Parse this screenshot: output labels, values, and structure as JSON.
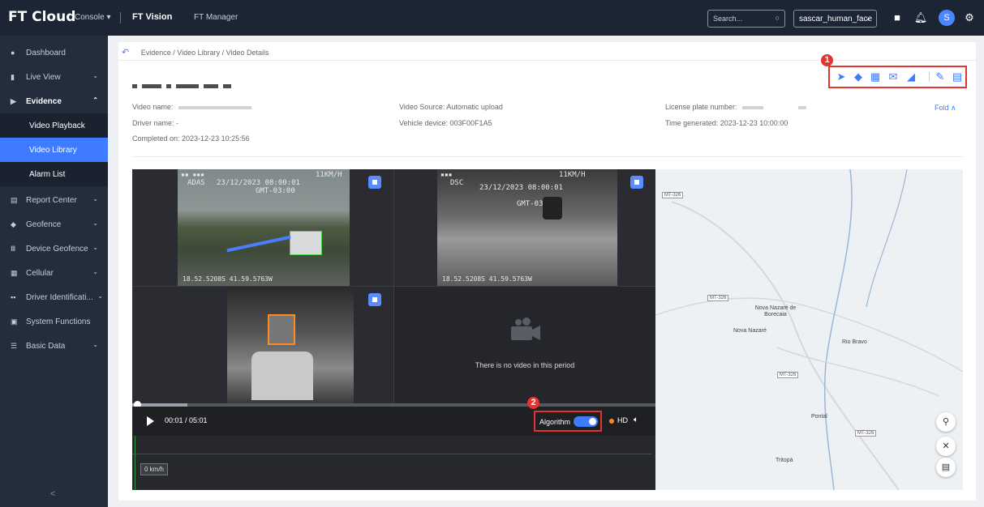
{
  "topbar": {
    "brand": "FT Cloud",
    "console": "Console ▾",
    "nav": [
      "FT Vision",
      "FT Manager"
    ],
    "search_placeholder": "Search...",
    "account": "sascar_human_face",
    "avatar_initial": "S"
  },
  "sidebar": {
    "items": [
      {
        "label": "Dashboard",
        "icon": "dashboard-icon"
      },
      {
        "label": "Live View",
        "icon": "live-icon",
        "chevron": "⌄"
      },
      {
        "label": "Evidence",
        "icon": "evidence-icon",
        "chevron": "⌃"
      },
      {
        "label": "Report Center",
        "icon": "report-icon",
        "chevron": "⌄"
      },
      {
        "label": "Geofence",
        "icon": "geofence-icon",
        "chevron": "⌄"
      },
      {
        "label": "Device Geofence",
        "icon": "device-geofence-icon",
        "chevron": "⌄"
      },
      {
        "label": "Cellular",
        "icon": "cellular-icon",
        "chevron": "⌄"
      },
      {
        "label": "Driver Identificati...",
        "icon": "driver-icon",
        "chevron": "⌄"
      },
      {
        "label": "System Functions",
        "icon": "system-icon"
      },
      {
        "label": "Basic Data",
        "icon": "data-icon",
        "chevron": "⌄"
      }
    ],
    "sub_items": [
      {
        "label": "Video Playback"
      },
      {
        "label": "Video Library",
        "active": true
      },
      {
        "label": "Alarm List"
      }
    ],
    "collapse": "<"
  },
  "breadcrumb": {
    "parts": "Evidence / Video Library / Video Details"
  },
  "callouts": [
    "1",
    "2"
  ],
  "details": {
    "video_name_label": "Video name:",
    "driver_name": "Driver name: -",
    "completed_on": "Completed on: 2023-12-23 10:25:56",
    "video_source": "Video Source: Automatic upload",
    "vehicle_device": "Vehicle device: 003F00F1A5",
    "license_plate_label": "License plate number:",
    "time_generated": "Time generated: 2023-12-23 10:00:00",
    "fold": "Fold ∧"
  },
  "cameras": {
    "cam1": {
      "top_left": "ADAS",
      "date": "23/12/2023 08:00:01",
      "gmt": "GMT-03:00",
      "speed": "11KM/H",
      "coords": "18.52.5208S 41.59.5763W"
    },
    "cam2": {
      "top_left": "DSC",
      "date": "23/12/2023 08:00:01",
      "gmt": "GMT-03:00",
      "speed": "11KM/H",
      "coords": "18.52.5208S 41.59.5763W"
    },
    "no_video": "There is no video in this period"
  },
  "player": {
    "time": "00:01 / 05:01",
    "progress_fraction": 0.003,
    "algorithm_label": "Algorithm",
    "algorithm_on": true,
    "hd": "HD",
    "speed_tag": "0 km/h"
  },
  "map": {
    "places": [
      "Nova Nazaré de Borecaia",
      "Nova Nazaré",
      "Rio Bravo",
      "Pontal",
      "Tritopá"
    ],
    "shields": [
      "MT-326",
      "MT-326",
      "MT-326",
      "MT-326"
    ]
  },
  "colors": {
    "accent": "#3f7bff",
    "sidebar": "#232d3b",
    "topbar": "#1c2533",
    "highlight": "#e3342f"
  }
}
